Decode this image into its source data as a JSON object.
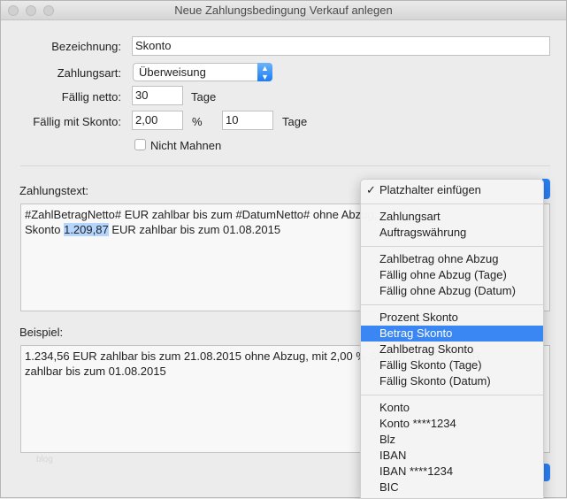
{
  "window": {
    "title": "Neue Zahlungsbedingung Verkauf anlegen"
  },
  "form": {
    "bezeichnung_label": "Bezeichnung:",
    "bezeichnung_value": "Skonto",
    "zahlungsart_label": "Zahlungsart:",
    "zahlungsart_value": "Überweisung",
    "faellig_netto_label": "Fällig netto:",
    "faellig_netto_value": "30",
    "tage1": "Tage",
    "faellig_skonto_label": "Fällig mit Skonto:",
    "skonto_percent_value": "2,00",
    "percent": "%",
    "skonto_days_value": "10",
    "tage2": "Tage",
    "nicht_mahnen_label": "Nicht Mahnen",
    "nicht_mahnen_checked": false
  },
  "zahlungstext": {
    "label": "Zahlungstext:",
    "line1": "#ZahlBetragNetto# EUR zahlbar bis zum #DatumNetto# ohne Abzug, mit 2,00 % ",
    "line2_pre": "Skonto ",
    "line2_sel": "1.209,87",
    "line2_post": " EUR zahlbar bis zum 01.08.2015"
  },
  "beispiel": {
    "label": "Beispiel:",
    "line1": "1.234,56 EUR zahlbar bis zum 21.08.2015 ohne Abzug, mit 2,00 % Skonto 1.209,87 EUR",
    "line2": "zahlbar bis zum 01.08.2015"
  },
  "watermark": "blog",
  "menu": {
    "title": "Platzhalter einfügen",
    "groups": [
      [
        "Zahlungsart",
        "Auftragswährung"
      ],
      [
        "Zahlbetrag ohne Abzug",
        "Fällig ohne Abzug (Tage)",
        "Fällig ohne Abzug (Datum)"
      ],
      [
        "Prozent Skonto",
        "Betrag Skonto",
        "Zahlbetrag Skonto",
        "Fällig Skonto (Tage)",
        "Fällig Skonto (Datum)"
      ],
      [
        "Konto",
        "Konto ****1234",
        "Blz",
        "IBAN",
        "IBAN ****1234",
        "BIC"
      ]
    ],
    "highlighted": "Betrag Skonto"
  }
}
